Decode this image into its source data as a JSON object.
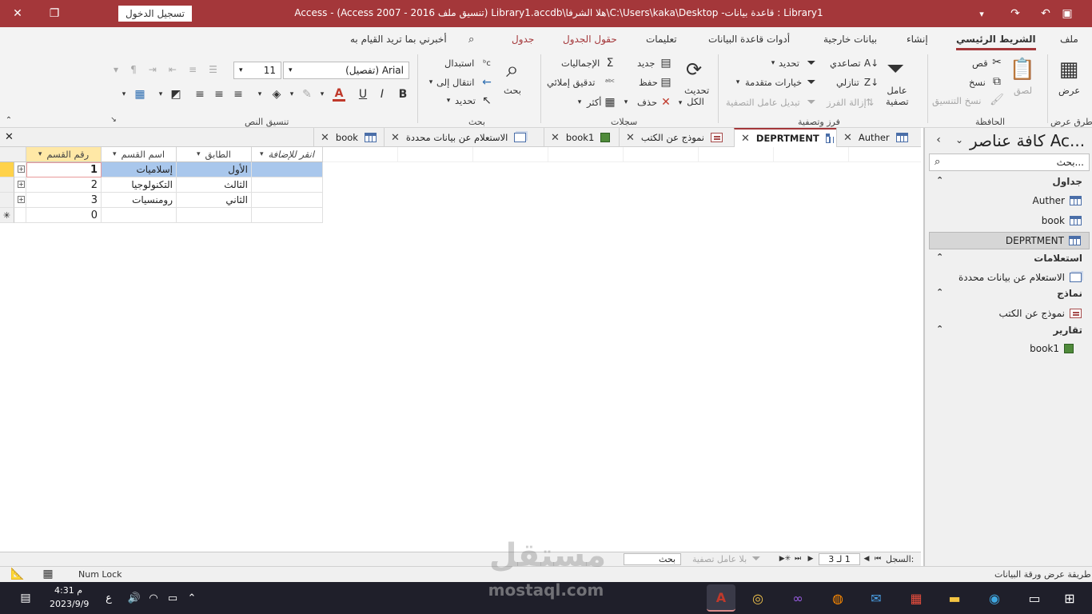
{
  "window": {
    "title": "Library1 : قاعدة بيانات- C:\\Users\\kaka\\Desktop\\هلا الشرفا\\Library1.accdb (تنسيق ملف Access 2007 - 2016)  -  Access",
    "sign_in": "تسجيل الدخول"
  },
  "ribbon_tabs": [
    "ملف",
    "الشريط الرئيسي",
    "إنشاء",
    "بيانات خارجية",
    "أدوات قاعدة البيانات",
    "تعليمات",
    "حقول الجدول",
    "جدول"
  ],
  "tell_me": "أخبرني بما تريد القيام به",
  "ribbon": {
    "views": {
      "view": "عرض",
      "group": "طرق عرض"
    },
    "clipboard": {
      "paste": "لصق",
      "cut": "قص",
      "copy": "نسخ",
      "format_painter": "نسخ التنسيق",
      "group": "الحافظة"
    },
    "sort_filter": {
      "filter": "عامل تصفية",
      "ascending": "تصاعدي",
      "descending": "تنازلي",
      "remove_sort": "إزالة الفرز",
      "selection": "تحديد",
      "advanced": "خيارات متقدمة",
      "toggle_filter": "تبديل عامل التصفية",
      "group": "فرز وتصفية"
    },
    "records": {
      "refresh": "تحديث الكل",
      "new": "جديد",
      "save": "حفظ",
      "delete": "حذف",
      "totals": "الإجماليات",
      "spelling": "تدقيق إملائي",
      "more": "أكثر",
      "group": "سجلات"
    },
    "find": {
      "find": "بحث",
      "replace": "استبدال",
      "goto": "انتقال إلى",
      "select": "تحديد",
      "group": "بحث"
    },
    "text_format": {
      "font": "Arial (تفصيل)",
      "size": "11",
      "group": "تنسيق النص"
    }
  },
  "nav": {
    "title": "كافة عناصر Ac...",
    "search_placeholder": "بحث...",
    "groups": [
      {
        "name": "جداول",
        "items": [
          "Auther",
          "book",
          "DEPRTMENT"
        ]
      },
      {
        "name": "استعلامات",
        "items": [
          "الاستعلام عن بيانات محددة"
        ]
      },
      {
        "name": "نماذج",
        "items": [
          "نموذج عن الكتب"
        ]
      },
      {
        "name": "تقارير",
        "items": [
          "book1"
        ]
      }
    ]
  },
  "doc_tabs": [
    "Auther",
    "DEPRTMENT",
    "نموذج عن الكتب",
    "book1",
    "الاستعلام عن بيانات محددة",
    "book"
  ],
  "sheet": {
    "columns": [
      "رقم القسم",
      "اسم القسم",
      "الطابق",
      "انقر للإضافة"
    ],
    "rows": [
      {
        "id": "1",
        "name": "إسلاميات",
        "floor": "الأول"
      },
      {
        "id": "2",
        "name": "التكنولوجيا",
        "floor": "الثالث"
      },
      {
        "id": "3",
        "name": "رومنسيات",
        "floor": "الثاني"
      }
    ],
    "new_row_id": "0"
  },
  "record_nav": {
    "label": "السجل:",
    "position": "1 لـ 3",
    "filter": "بلا عامل تصفية",
    "search": "بحث"
  },
  "status": {
    "left": "طريقة عرض ورقة البيانات",
    "num_lock": "Num Lock"
  },
  "taskbar": {
    "time": "4:31 م",
    "date": "2023/9/9",
    "lang": "ع"
  },
  "watermark": {
    "ar": "مستقل",
    "en": "mostaql.com"
  },
  "colors": {
    "accent": "#a4373a",
    "selected_header": "#ffe8a6",
    "selected_cell": "#a9c7ec"
  }
}
